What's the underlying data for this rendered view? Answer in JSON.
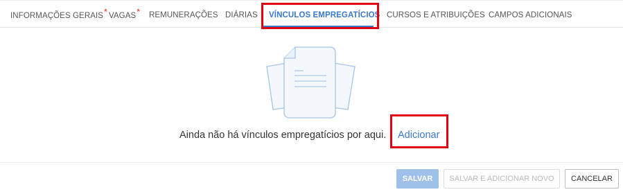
{
  "tabs": [
    {
      "label": "INFORMAÇÕES GERAIS",
      "required": true
    },
    {
      "label": "VAGAS",
      "required": true
    },
    {
      "label": "REMUNERAÇÕES",
      "required": false
    },
    {
      "label": "DIÁRIAS",
      "required": false
    },
    {
      "label": "VÍNCULOS EMPREGATÍCIOS",
      "required": false,
      "active": true
    },
    {
      "label": "CURSOS E ATRIBUIÇÕES",
      "required": false
    },
    {
      "label": "CAMPOS ADICIONAIS",
      "required": false
    }
  ],
  "required_marker": "*",
  "empty_state": {
    "icon": "document-stack-icon",
    "message": "Ainda não há vínculos empregatícios por aqui.",
    "add_link": "Adicionar"
  },
  "footer": {
    "save_label": "SALVAR",
    "save_new_label": "SALVAR E ADICIONAR NOVO",
    "cancel_label": "CANCELAR"
  },
  "colors": {
    "accent": "#3a78c9",
    "highlight": "#e0000f",
    "required": "#d9262b"
  }
}
